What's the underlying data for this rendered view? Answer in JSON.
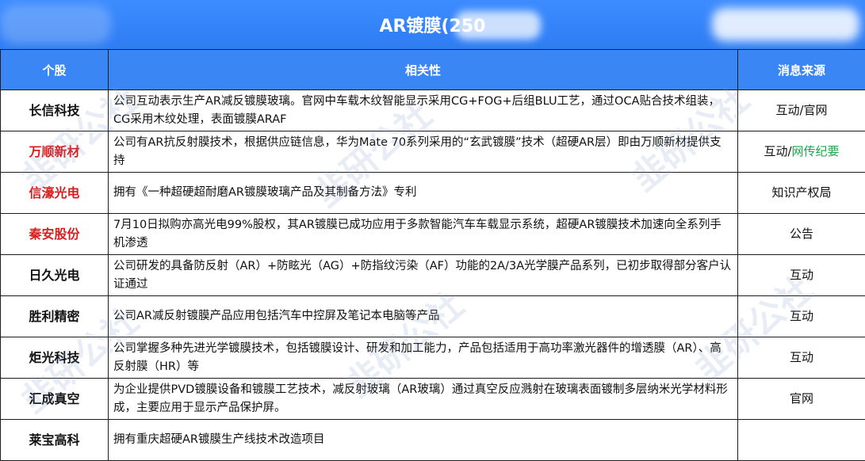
{
  "title": "AR镀膜(250",
  "headers": {
    "stock": "个股",
    "relevance": "相关性",
    "source": "消息来源"
  },
  "rows": [
    {
      "stock": "长信科技",
      "highlight": false,
      "relevance": "公司互动表示生产AR减反镀膜玻璃。官网中车载木纹智能显示采用CG+FOG+后组BLU工艺，通过OCA贴合技术组装，CG采用木纹处理，表面镀膜ARAF",
      "source": "互动/官网",
      "source_extra": ""
    },
    {
      "stock": "万顺新材",
      "highlight": true,
      "relevance": "公司有AR抗反射膜技术，根据供应链信息，华为Mate 70系列采用的“玄武镀膜”技术（超硬AR层）即由万顺新材提供支持",
      "source": "互动/",
      "source_extra": "网传纪要"
    },
    {
      "stock": "信濠光电",
      "highlight": true,
      "relevance": "拥有《一种超硬超耐磨AR镀膜玻璃产品及其制备方法》专利",
      "source": "知识产权局",
      "source_extra": ""
    },
    {
      "stock": "秦安股份",
      "highlight": true,
      "relevance": "7月10日拟购亦高光电99%股权，其AR镀膜已成功应用于多款智能汽车车载显示系统，超硬AR镀膜技术加速向全系列手机渗透",
      "source": "公告",
      "source_extra": ""
    },
    {
      "stock": "日久光电",
      "highlight": false,
      "relevance": "公司研发的具备防反射（AR）+防眩光（AG）+防指纹污染（AF）功能的2A/3A光学膜产品系列，已初步取得部分客户认证通过",
      "source": "互动",
      "source_extra": ""
    },
    {
      "stock": "胜利精密",
      "highlight": false,
      "relevance": "公司AR减反射镀膜产品应用包括汽车中控屏及笔记本电脑等产品",
      "source": "互动",
      "source_extra": ""
    },
    {
      "stock": "炬光科技",
      "highlight": false,
      "relevance": "公司掌握多种先进光学镀膜技术，包括镀膜设计、研发和加工能力，产品包括适用于高功率激光器件的增透膜（AR）、高反射膜（HR）等",
      "source": "互动",
      "source_extra": ""
    },
    {
      "stock": "汇成真空",
      "highlight": false,
      "relevance": "为企业提供PVD镀膜设备和镀膜工艺技术，减反射玻璃（AR玻璃）通过真空反应溅射在玻璃表面镀制多层纳米光学材料形成，主要应用于显示产品保护屏。",
      "source": "官网",
      "source_extra": ""
    },
    {
      "stock": "莱宝高科",
      "highlight": false,
      "relevance": "拥有重庆超硬AR镀膜生产线技术改造项目",
      "source": "",
      "source_extra": ""
    }
  ],
  "colors": {
    "header_bg": "#3a86f5",
    "title_bg": "#2f7cf3",
    "highlight_text": "#d81f1f",
    "source_extra": "#1aa64b"
  }
}
